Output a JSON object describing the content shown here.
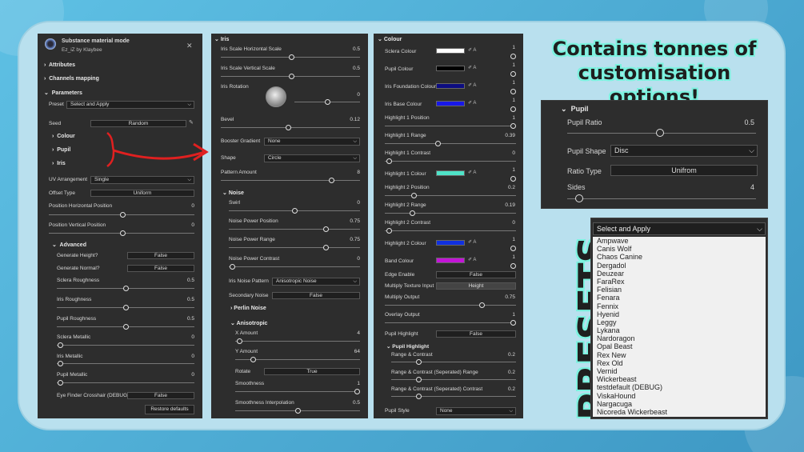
{
  "left": {
    "title": "Substance material mode",
    "subtitle": "Ez_iZ by Klaybee",
    "attributes": "Attributes",
    "channels": "Channels mapping",
    "parameters": "Parameters",
    "preset_label": "Preset",
    "preset_value": "Select and Apply",
    "seed_label": "Seed",
    "seed_value": "Random",
    "colour_group": "Colour",
    "pupil_group": "Pupil",
    "iris_group": "Iris",
    "uv_label": "UV Arrangement",
    "uv_value": "Single",
    "offset_label": "Offset Type",
    "offset_value": "Uniform",
    "pos_h_label": "Position Horizontal Position",
    "pos_h_value": "0",
    "pos_v_label": "Position Vertical Position",
    "pos_v_value": "0",
    "advanced": "Advanced",
    "gen_height_label": "Generate Height?",
    "gen_height_value": "False",
    "gen_normal_label": "Generate Normal?",
    "gen_normal_value": "False",
    "sclera_rough_label": "Sclera Roughness",
    "sclera_rough_value": "0.5",
    "iris_rough_label": "Iris Roughness",
    "iris_rough_value": "0.5",
    "pupil_rough_label": "Pupil Roughness",
    "pupil_rough_value": "0.5",
    "sclera_metal_label": "Sclera Metallic",
    "sclera_metal_value": "0",
    "iris_metal_label": "Iris Metallic",
    "iris_metal_value": "0",
    "pupil_metal_label": "Pupil Metallic",
    "pupil_metal_value": "0",
    "eye_finder_label": "Eye Finder Crosshair (DEBUG)",
    "eye_finder_value": "False",
    "restore": "Restore defaults"
  },
  "mid": {
    "iris": "Iris",
    "iris_h_label": "Iris Scale Horizontal Scale",
    "iris_h_value": "0.5",
    "iris_v_label": "Iris Scale Vertical Scale",
    "iris_v_value": "0.5",
    "iris_rot_label": "Iris Rotation",
    "iris_rot_value": "0",
    "bevel_label": "Bevel",
    "bevel_value": "0.12",
    "booster_label": "Booster Gradient",
    "booster_value": "None",
    "shape_label": "Shape",
    "shape_value": "Circle",
    "pattern_label": "Pattern Amount",
    "pattern_value": "8",
    "noise": "Noise",
    "swirl_label": "Swirl",
    "swirl_value": "0",
    "npp_label": "Noise Power Position",
    "npp_value": "0.75",
    "npr_label": "Noise Power Range",
    "npr_value": "0.75",
    "npc_label": "Noise Power Contrast",
    "npc_value": "0",
    "inp_label": "Iris Noise Pattern",
    "inp_value": "Anisotropic Noise",
    "secnoise_label": "Secondary Noise",
    "secnoise_value": "False",
    "perlin": "Perlin Noise",
    "aniso": "Anisotropic",
    "xamt_label": "X Amount",
    "xamt_value": "4",
    "yamt_label": "Y Amount",
    "yamt_value": "64",
    "rotate_label": "Rotate",
    "rotate_value": "True",
    "smooth_label": "Smoothness",
    "smooth_value": "1",
    "smoothi_label": "Smoothness Interpolation",
    "smoothi_value": "0.5"
  },
  "col": {
    "colour": "Colour",
    "one": "1",
    "sclera_label": "Sclera Colour",
    "pupil_label": "Pupil Colour",
    "irisfound_label": "Iris Foundation Colour",
    "irisbase_label": "Iris Base Colour",
    "h1pos_label": "Highlight 1 Position",
    "h1pos_value": "1",
    "h1rng_label": "Highlight 1 Range",
    "h1rng_value": "0.39",
    "h1con_label": "Highlight 1 Contrast",
    "h1con_value": "0",
    "h1col_label": "Highlight 1 Colour",
    "h2pos_label": "Highlight 2 Position",
    "h2pos_value": "0.2",
    "h2rng_label": "Highlight 2 Range",
    "h2rng_value": "0.19",
    "h2con_label": "Highlight 2 Contrast",
    "h2con_value": "0",
    "h2col_label": "Highlight 2 Colour",
    "band_label": "Band Colour",
    "edge_label": "Edge Enable",
    "edge_value": "False",
    "mtex_label": "Multiply Texture Input",
    "mtex_value": "Height",
    "mout_label": "Multiply Output",
    "mout_value": "0.75",
    "oout_label": "Overlay Output",
    "oout_value": "1",
    "phl_label": "Pupil Highlight",
    "phl_value": "False",
    "phg": "Pupil Highlight",
    "rc_label": "Range & Contrast",
    "rc_value": "0.2",
    "rcsr_label": "Range & Contrast (Seperated) Range",
    "rcsr_value": "0.2",
    "rcsc_label": "Range & Contrast (Seperated) Contrast",
    "rcsc_value": "0.2",
    "pstyle_label": "Pupil Style",
    "pstyle_value": "None",
    "colors": {
      "sclera": "#ffffff",
      "pupil": "#000000",
      "iris_foundation": "#0c0c80",
      "iris_base": "#1818e8",
      "highlight1": "#4fe3c8",
      "highlight2": "#1030e0",
      "band": "#c414d8"
    }
  },
  "promo": {
    "line1": "Contains tonnes of",
    "line2": "customisation options!",
    "presets": "PRESETS"
  },
  "pupil": {
    "title": "Pupil",
    "ratio_label": "Pupil Ratio",
    "ratio_value": "0.5",
    "shape_label": "Pupil Shape",
    "shape_value": "Disc",
    "rtype_label": "Ratio Type",
    "rtype_value": "Unifrom",
    "sides_label": "Sides",
    "sides_value": "4"
  },
  "presets": {
    "selected": "Select and Apply",
    "items": [
      "Ampwave",
      "Canis Wolf",
      "Chaos Canine",
      "Dergadol",
      "Deuzear",
      "FaraRex",
      "Felisian",
      "Fenara",
      "Fennix",
      "Hyenid",
      "Leggy",
      "Lykana",
      "Nardoragon",
      "Opal Beast",
      "Rex New",
      "Rex Old",
      "Vernid",
      "Wickerbeast",
      "testdefault (DEBUG)",
      "ViskaHound",
      "Nargacuga",
      "Nicoreda Wickerbeast"
    ]
  }
}
